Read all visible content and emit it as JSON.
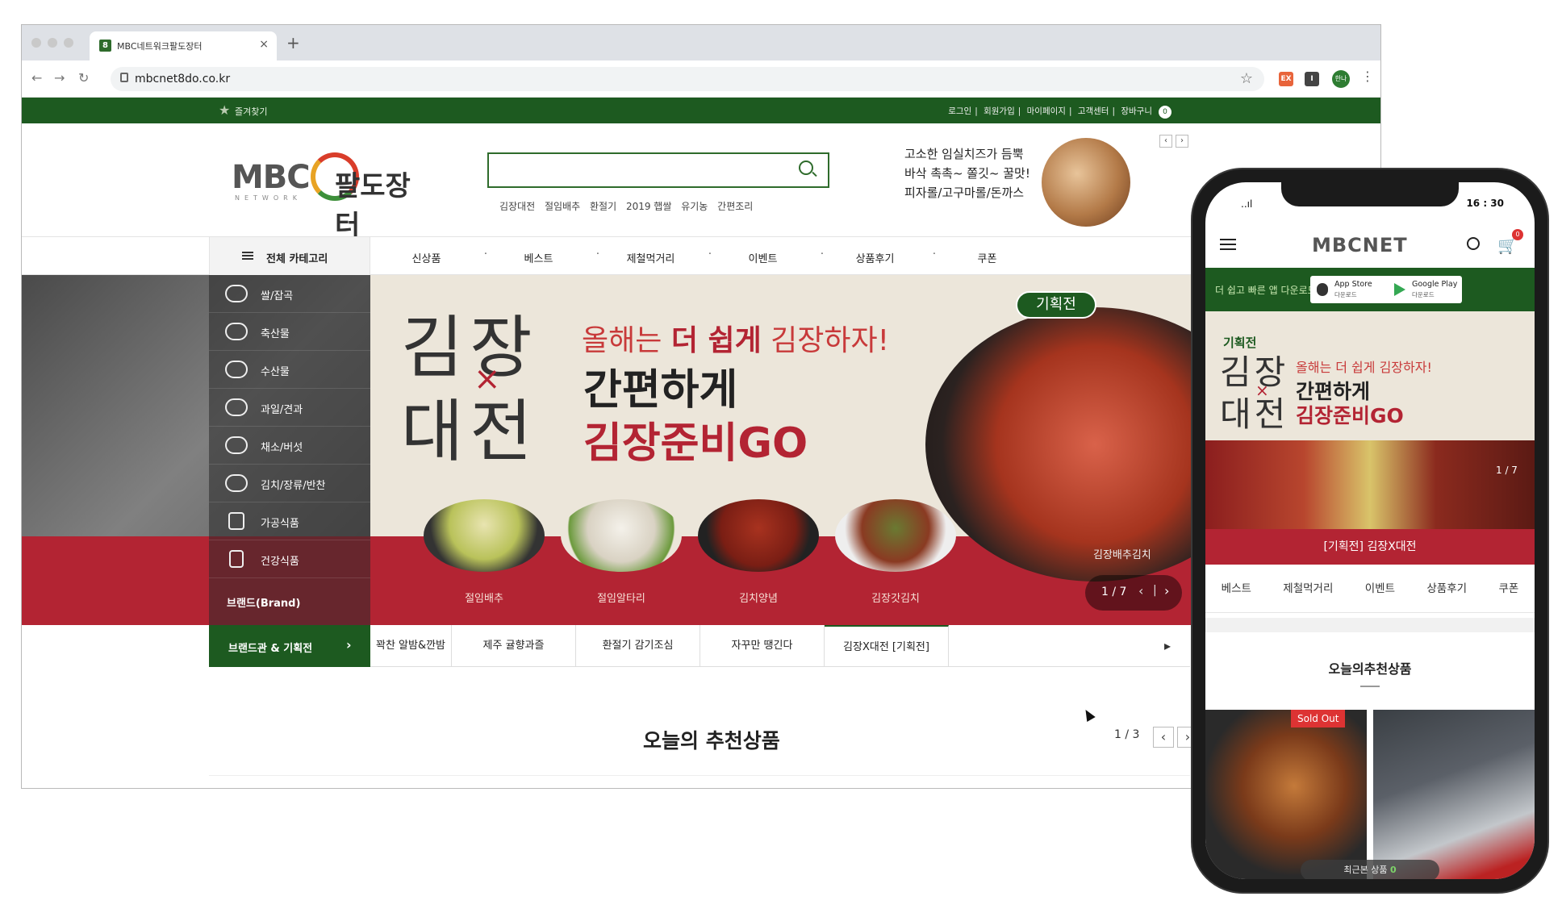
{
  "browser": {
    "tab_title": "MBC네트워크팔도장터",
    "favicon_text": "8",
    "url": "mbcnet8do.co.kr",
    "profile_label": "한나"
  },
  "site": {
    "favorites_label": "즐겨찾기",
    "top_links": [
      "로그인",
      "회원가입",
      "마이페이지",
      "고객센터",
      "장바구니"
    ],
    "cart_count": "0",
    "logo": {
      "mbc": "MBC",
      "name": "팔도장터",
      "network": "NETWORK"
    },
    "search_keywords": [
      "김장대전",
      "절임배추",
      "환절기",
      "2019 햅쌀",
      "유기농",
      "간편조리"
    ],
    "promo_lines": [
      "고소한 임실치즈가 듬뿍",
      "바삭 촉촉~ 쫄깃~ 꿀맛!",
      "피자롤/고구마롤/돈까스"
    ],
    "all_categories_label": "전체 카테고리",
    "nav": [
      "신상품",
      "베스트",
      "제철먹거리",
      "이벤트",
      "상품후기",
      "쿠폰"
    ],
    "side_categories": [
      "쌀/잡곡",
      "축산물",
      "수산물",
      "과일/견과",
      "채소/버섯",
      "김치/장류/반찬",
      "가공식품",
      "건강식품"
    ],
    "brand_label": "브랜드(Brand)",
    "hero": {
      "big_1": "김장",
      "big_2": "대전",
      "x": "×",
      "sub1_pre": "올해는 ",
      "sub1_bold": "더 쉽게",
      "sub1_post": " 김장하자!",
      "sub2": "간편하게",
      "sub3": "김장준비GO",
      "pill": "기획전",
      "items": [
        "절임배추",
        "절임알타리",
        "김치양념",
        "김장갓김치"
      ],
      "kimchi_label": "김장배추김치",
      "pager": "1 / 7"
    },
    "brand_bar": {
      "button": "브랜드관 & 기획전",
      "tabs": [
        "꽉찬 알밤&깐밤",
        "제주 귤향과즐",
        "환절기 감기조심",
        "자꾸만 땡긴다",
        "김장X대전 [기획전]"
      ],
      "active_index": 4
    },
    "recommend": {
      "title": "오늘의 추천상품",
      "pager": "1 / 3"
    }
  },
  "phone": {
    "signal": "..ıl",
    "time": "16 : 30",
    "logo": "MBCNET",
    "cart_badge": "0",
    "app_bar_label": "더 쉽고 빠른 앱 다운로드",
    "app_store": {
      "t1": "App Store",
      "t2": "다운로드"
    },
    "google_play": {
      "t1": "Google Play",
      "t2": "다운로드"
    },
    "hero": {
      "tag": "기획전",
      "big_1": "김장",
      "big_2": "대전",
      "x": "×",
      "sub1": "올해는 더 쉽게 김장하자!",
      "sub2": "간편하게",
      "sub3": "김장준비GO",
      "pager": "1 / 7"
    },
    "caption": "[기획전] 김장X대전",
    "tabs": [
      "베스트",
      "제철먹거리",
      "이벤트",
      "상품후기",
      "쿠폰"
    ],
    "recommend_title": "오늘의추천상품",
    "sold_out": "Sold Out",
    "recent_label": "최근본 상품",
    "recent_count": "0"
  }
}
